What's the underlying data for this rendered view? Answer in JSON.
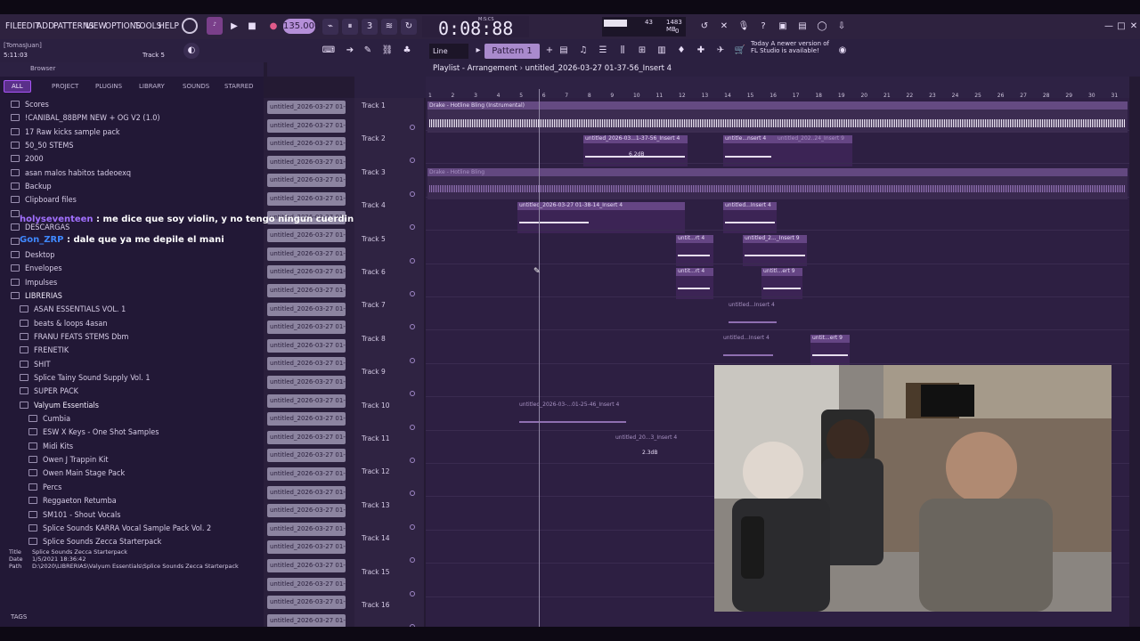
{
  "menu": [
    "FILE",
    "EDIT",
    "ADD",
    "PATTERNS",
    "VIEW",
    "OPTIONS",
    "TOOLS",
    "HELP"
  ],
  "tempo": "135.000",
  "time": "0:08:88",
  "time_label": "M:S:CS",
  "cpu": {
    "v1": "43",
    "v2": "1483 MB",
    "v3": "0"
  },
  "hint": "[TomasJuan]",
  "timepos": "5:11:03",
  "track_label": "Track 5",
  "line_mode": "Line",
  "pattern": "Pattern 1",
  "news": {
    "line1": "Today  A newer version of",
    "line2": "FL Studio is available!"
  },
  "browser": {
    "title": "Browser",
    "tabs": [
      "ALL",
      "PROJECT",
      "PLUGINS",
      "LIBRARY",
      "SOUNDS",
      "STARRED"
    ],
    "items": [
      "Scores",
      "!CANIBAL_88BPM NEW + OG V2 (1.0)",
      "17 Raw kicks sample pack",
      "50_50 STEMS",
      "2000",
      "asan malos habitos tadeoexq",
      "Backup",
      "Clipboard files",
      "",
      "DESCARGAS",
      "",
      "Desktop",
      "Envelopes",
      "Impulses",
      "LIBRERIAS",
      "ASAN ESSENTIALS VOL. 1",
      "beats & loops 4asan",
      "FRANU FEATS STEMS Dbm",
      "FRENETIK",
      "SHIT",
      "Splice Tainy Sound Supply Vol. 1",
      "SUPER PACK",
      "Valyum Essentials",
      "Cumbia",
      "ESW X Keys - One Shot Samples",
      "Midi Kits",
      "Owen J Trappin Kit",
      "Owen Main Stage Pack",
      "Percs",
      "Reggaeton Retumba",
      "SM101 - Shout Vocals",
      "Splice Sounds KARRA Vocal Sample Pack Vol. 2",
      "Splice Sounds Zecca Starterpack"
    ],
    "info": {
      "title_k": "Title",
      "title_v": "Splice Sounds Zecca Starterpack",
      "date_k": "Date",
      "date_v": "1/5/2021 18:36:42",
      "path_k": "Path",
      "path_v": "D:\\2020\\LIBRERIAS\\Valyum Essentials\\Splice Sounds Zecca Starterpack"
    },
    "tags": "TAGS"
  },
  "channel_label": "untitled_2026-03-27 01-...",
  "playlist": {
    "title": "Playlist - Arrangement",
    "file": "untitled_2026-03-27 01-37-56_Insert 4",
    "ruler": [
      "1",
      "2",
      "3",
      "4",
      "5",
      "6",
      "7",
      "8",
      "9",
      "10",
      "11",
      "12",
      "13",
      "14",
      "15",
      "16",
      "17",
      "18",
      "19",
      "20",
      "21",
      "22",
      "23",
      "24",
      "25",
      "26",
      "27",
      "28",
      "29",
      "30",
      "31"
    ],
    "tracks": [
      "Track 1",
      "Track 2",
      "Track 3",
      "Track 4",
      "Track 5",
      "Track 6",
      "Track 7",
      "Track 8",
      "Track 9",
      "Track 10",
      "Track 11",
      "Track 12",
      "Track 13",
      "Track 14",
      "Track 15",
      "Track 16"
    ],
    "clips": {
      "c1": "Drake - Hotline Bling (Instrumental)",
      "c2": "untitled_2026-03...1-37-56_Insert 4",
      "c2b": "untitle...nsert 4",
      "c2c": "untitled_202..24_Insert 9",
      "c3": "Drake - Hotline Bling",
      "c4": "untitled_2026-03-27 01-38-14_Insert 4",
      "c4b": "untitled...Insert 4",
      "c5": "untit...rt 4",
      "c5b": "untitled_2..._Insert 9",
      "c6": "untit...rt 4",
      "c6b": "untitl...ert 9",
      "c7": "untitled...Insert 4",
      "c8": "untitled...Insert 4",
      "c8b": "untit...ert 9",
      "c10": "untitled_2026-03-...01-25-46_Insert 4",
      "c11": "untitled_20...3_Insert 4",
      "db1": "6.2dB",
      "db2": "2.3dB"
    }
  },
  "chat": [
    {
      "user": "holyseventeen",
      "msg": " : me dice que soy violin, y no tengo ningun cuerdin"
    },
    {
      "user": "Gon_ZRP",
      "msg": " : dale que ya me depile el mani"
    }
  ]
}
